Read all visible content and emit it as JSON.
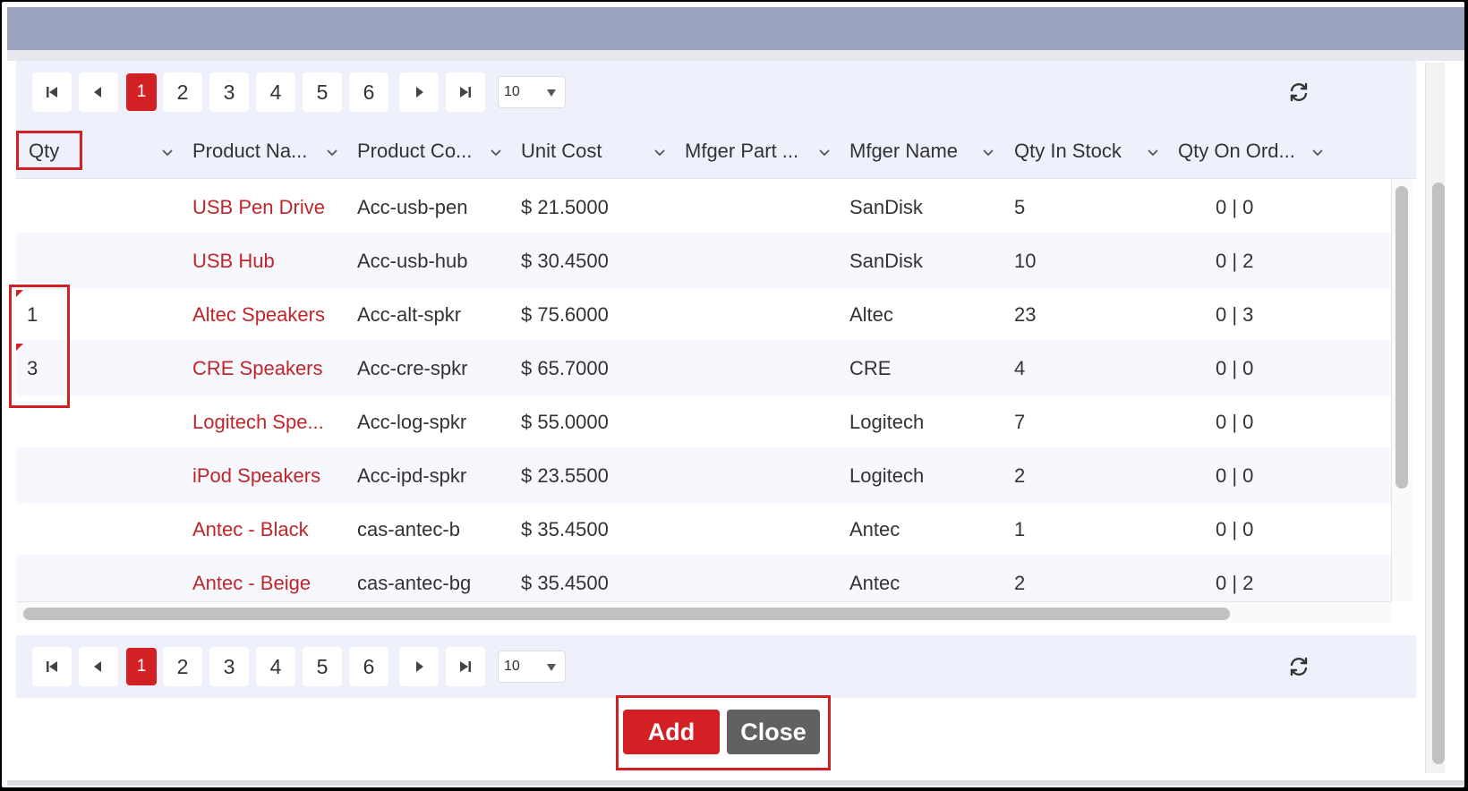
{
  "pager": {
    "pages": [
      "1",
      "2",
      "3",
      "4",
      "5",
      "6"
    ],
    "active_page": "1",
    "page_size": "10"
  },
  "columns": [
    "Qty",
    "Product Na...",
    "Product Co...",
    "Unit Cost",
    "Mfger Part ...",
    "Mfger Name",
    "Qty In Stock",
    "Qty On Ord..."
  ],
  "rows": [
    {
      "qty": "",
      "name": "USB Pen Drive",
      "code": "Acc-usb-pen",
      "cost": "$ 21.5000",
      "part": "",
      "mfger": "SanDisk",
      "stock": "5",
      "onorder": "0 | 0"
    },
    {
      "qty": "",
      "name": "USB Hub",
      "code": "Acc-usb-hub",
      "cost": "$ 30.4500",
      "part": "",
      "mfger": "SanDisk",
      "stock": "10",
      "onorder": "0 | 2"
    },
    {
      "qty": "1",
      "name": "Altec Speakers",
      "code": "Acc-alt-spkr",
      "cost": "$ 75.6000",
      "part": "",
      "mfger": "Altec",
      "stock": "23",
      "onorder": "0 | 3"
    },
    {
      "qty": "3",
      "name": "CRE Speakers",
      "code": "Acc-cre-spkr",
      "cost": "$ 65.7000",
      "part": "",
      "mfger": "CRE",
      "stock": "4",
      "onorder": "0 | 0"
    },
    {
      "qty": "",
      "name": "Logitech Spe...",
      "code": "Acc-log-spkr",
      "cost": "$ 55.0000",
      "part": "",
      "mfger": "Logitech",
      "stock": "7",
      "onorder": "0 | 0"
    },
    {
      "qty": "",
      "name": "iPod Speakers",
      "code": "Acc-ipd-spkr",
      "cost": "$ 23.5500",
      "part": "",
      "mfger": "Logitech",
      "stock": "2",
      "onorder": "0 | 0"
    },
    {
      "qty": "",
      "name": "Antec - Black",
      "code": "cas-antec-b",
      "cost": "$ 35.4500",
      "part": "",
      "mfger": "Antec",
      "stock": "1",
      "onorder": "0 | 0"
    },
    {
      "qty": "",
      "name": "Antec - Beige",
      "code": "cas-antec-bg",
      "cost": "$ 35.4500",
      "part": "",
      "mfger": "Antec",
      "stock": "2",
      "onorder": "0 | 2"
    }
  ],
  "footer": {
    "add_label": "Add",
    "close_label": "Close"
  },
  "colors": {
    "accent": "#d32024",
    "link": "#c0262b",
    "header_bg": "#eef0fb",
    "titlebar": "#9ba3bf"
  }
}
